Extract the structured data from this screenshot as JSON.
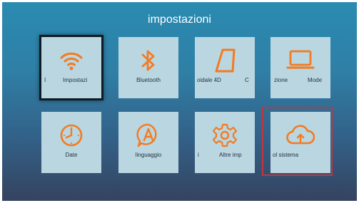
{
  "title": "impostazioni",
  "tiles": [
    {
      "icon": "wifi-icon",
      "label": "Impostazi",
      "left_fragment": "I",
      "right_fragment": ""
    },
    {
      "icon": "bluetooth-icon",
      "label": "Bluetooth",
      "left_fragment": "",
      "right_fragment": ""
    },
    {
      "icon": "keystone-trapezoid-icon",
      "label": "oidale 4D",
      "left_fragment": "",
      "right_fragment": "C"
    },
    {
      "icon": "monitor-icon",
      "label": "zione",
      "left_fragment": "",
      "right_fragment": "Mode"
    },
    {
      "icon": "clock-icon",
      "label": "Date",
      "left_fragment": "",
      "right_fragment": ""
    },
    {
      "icon": "language-a-icon",
      "label": "linguaggio",
      "left_fragment": "",
      "right_fragment": ""
    },
    {
      "icon": "gear-icon",
      "label": "Altre imp",
      "left_fragment": "i",
      "right_fragment": ""
    },
    {
      "icon": "cloud-upload-icon",
      "label": "ol sistema",
      "left_fragment": "",
      "right_fragment": ""
    }
  ],
  "colors": {
    "accent": "#f47b20",
    "highlight": "#c6343b",
    "tile": "#b9d6e1"
  }
}
